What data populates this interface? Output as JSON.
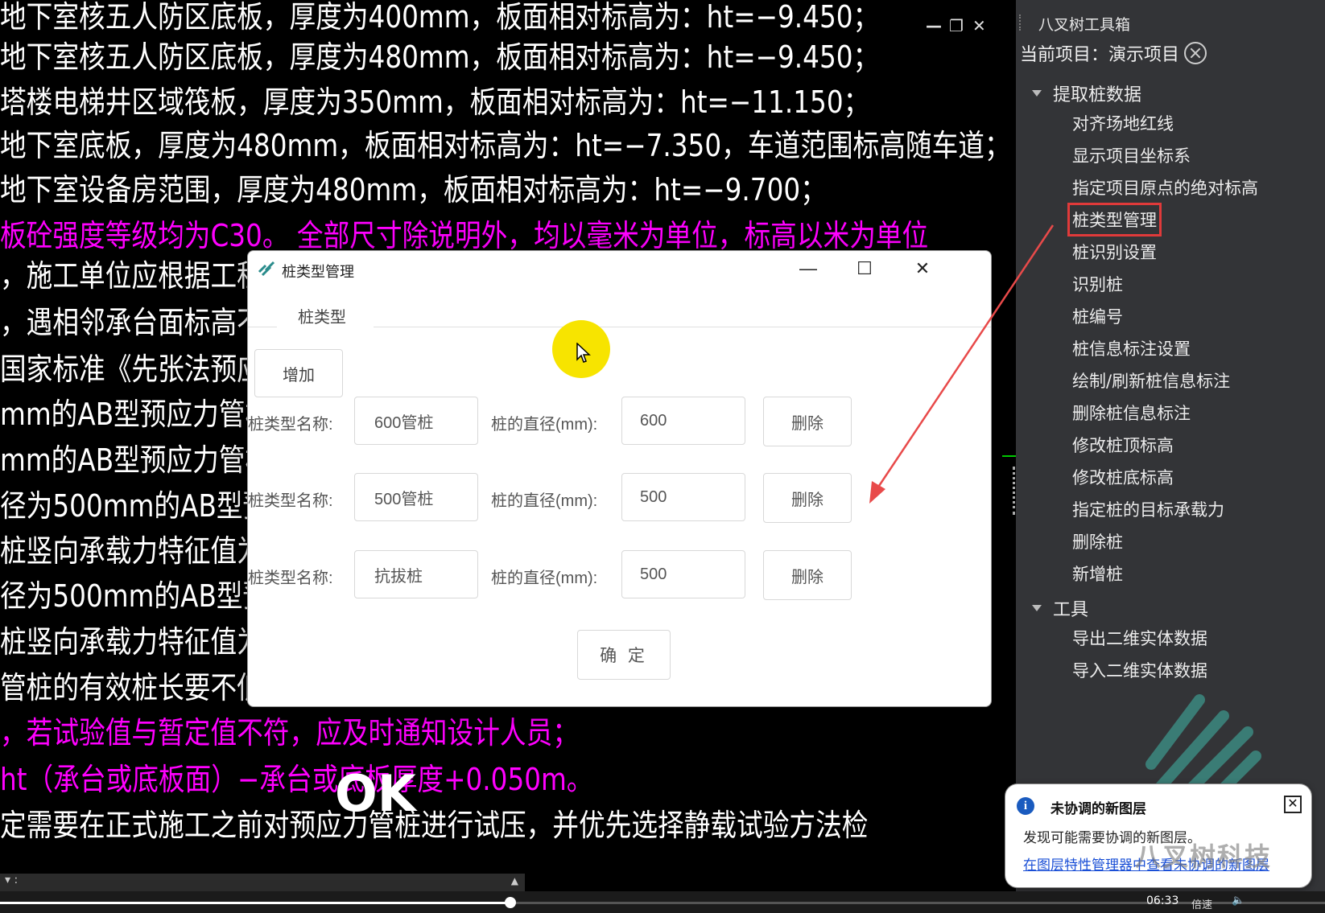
{
  "cad": {
    "lines": [
      {
        "text": "地下室核五人防区底板，厚度为400mm，板面相对标高为：ht=−9.450；",
        "magenta": false
      },
      {
        "text": "地下室核五人防区底板，厚度为480mm，板面相对标高为：ht=−9.450；",
        "magenta": false
      },
      {
        "text": "塔楼电梯井区域筏板，厚度为350mm，板面相对标高为：ht=−11.150；",
        "magenta": false
      },
      {
        "text": "地下室底板，厚度为480mm，板面相对标高为：ht=−7.350，车道范围标高随车道；",
        "magenta": false
      },
      {
        "text": "地下室设备房范围，厚度为480mm，板面相对标高为：ht=−9.700；",
        "magenta": false
      },
      {
        "text": "板砼强度等级均为C30。    全部尺寸除说明外，均以毫米为单位，标高以米为单位",
        "magenta": true
      },
      {
        "text": "，施工单位应根据工程地质",
        "magenta": false
      },
      {
        "text": "，遇相邻承台面标高不同时",
        "magenta": false
      },
      {
        "text": "国家标准《先张法预应力混",
        "magenta": false
      },
      {
        "text": "mm的AB型预应力管桩，",
        "magenta": false
      },
      {
        "text": "mm的AB型预应力管桩，",
        "magenta": false
      },
      {
        "text": "径为500mm的AB型预应",
        "magenta": false
      },
      {
        "text": "桩竖向承载力特征值为20",
        "magenta": false
      },
      {
        "text": "径为500mm的AB型预应",
        "magenta": false
      },
      {
        "text": "桩竖向承载力特征值为20",
        "magenta": false
      },
      {
        "text": "管桩的有效桩长要不低于30米，若不满足应及时通知设计处理。",
        "magenta": false
      },
      {
        "text": "，若试验值与暂定值不符，应及时通知设计人员；",
        "magenta": true
      },
      {
        "text": "ht（承台或底板面）−承台或底板厚度+0.050m。",
        "magenta": true
      },
      {
        "text": "定需要在正式施工之前对预应力管桩进行试压，并优先选择静载试验方法检",
        "magenta": false
      }
    ],
    "window_controls": [
      "—",
      "❐",
      "✕"
    ],
    "command_line": "▾ :"
  },
  "toolbox": {
    "title": "八叉树工具箱",
    "project_label": "当前项目：演示项目",
    "groups": [
      {
        "label": "提取桩数据",
        "items": [
          "对齐场地红线",
          "显示项目坐标系",
          "指定项目原点的绝对标高",
          "桩类型管理",
          "桩识别设置",
          "识别桩",
          "桩编号",
          "桩信息标注设置",
          "绘制/刷新桩信息标注",
          "删除桩信息标注",
          "修改桩顶标高",
          "修改桩底标高",
          "指定桩的目标承载力",
          "删除桩",
          "新增桩"
        ]
      },
      {
        "label": "工具",
        "items": [
          "导出二维实体数据",
          "导入二维实体数据"
        ]
      }
    ],
    "highlighted_item": "桩类型管理"
  },
  "dialog": {
    "title": "桩类型管理",
    "tab": "桩类型",
    "add_button": "增加",
    "name_label": "桩类型名称:",
    "diameter_label": "桩的直径(mm):",
    "delete_button": "删除",
    "rows": [
      {
        "name": "600管桩",
        "diameter": "600"
      },
      {
        "name": "500管桩",
        "diameter": "500"
      },
      {
        "name": "抗拔桩",
        "diameter": "500"
      }
    ],
    "ok_button": "确 定"
  },
  "notification": {
    "title": "未协调的新图层",
    "body": "发现可能需要协调的新图层。",
    "link": "在图层特性管理器中查看未协调的新图层"
  },
  "overlay": {
    "caption": "OK",
    "watermark": "八叉树科技"
  },
  "player": {
    "time": "06:33",
    "speed": "倍速",
    "progress": 0.385
  },
  "colors": {
    "highlight": "#e03a3a",
    "magenta": "#ff00ff",
    "cursor_dot": "#f7e400",
    "link": "#1a4fd6"
  }
}
